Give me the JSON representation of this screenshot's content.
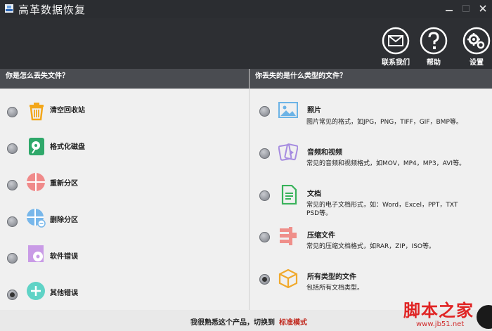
{
  "window": {
    "title": "高革数据恢复"
  },
  "header": {
    "contact_label": "联系我们",
    "help_label": "帮助",
    "settings_label": "设置"
  },
  "left": {
    "heading": "你是怎么丢失文件？",
    "items": [
      {
        "label": "清空回收站",
        "icon": "recycle-bin-icon",
        "checked": false
      },
      {
        "label": "格式化磁盘",
        "icon": "formatted-disk-icon",
        "checked": false
      },
      {
        "label": "重新分区",
        "icon": "repartition-icon",
        "checked": false
      },
      {
        "label": "删除分区",
        "icon": "delete-partition-icon",
        "checked": false
      },
      {
        "label": "软件错误",
        "icon": "software-error-icon",
        "checked": false
      },
      {
        "label": "其他错误",
        "icon": "other-error-icon",
        "checked": true
      }
    ]
  },
  "right": {
    "heading": "你丢失的是什么类型的文件？",
    "items": [
      {
        "label": "照片",
        "desc": "图片常见的格式，如JPG，PNG，TIFF，GIF，BMP等。",
        "icon": "photo-icon",
        "checked": false
      },
      {
        "label": "音频和视频",
        "desc": "常见的音频和视频格式，如MOV，MP4，MP3，AVI等。",
        "icon": "audio-video-icon",
        "checked": false
      },
      {
        "label": "文档",
        "desc": "常见的电子文档形式，如：Word，Excel，PPT，TXT PSD等。",
        "icon": "document-icon",
        "checked": false
      },
      {
        "label": "压缩文件",
        "desc": "常见的压缩文档格式，如RAR，ZIP，ISO等。",
        "icon": "archive-icon",
        "checked": false
      },
      {
        "label": "所有类型的文件",
        "desc": "包括所有文档类型。",
        "icon": "all-files-icon",
        "checked": true
      }
    ]
  },
  "bottom": {
    "text": "我很熟悉这个产品，切换到",
    "link": "标准模式"
  },
  "watermark": {
    "title": "脚本之家",
    "url": "www.jb51.net"
  },
  "colors": {
    "accent": "#c0271c",
    "header_bg": "#2d2f33",
    "bar_bg": "#4a4c51"
  }
}
